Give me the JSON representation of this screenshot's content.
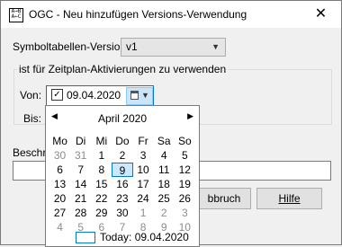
{
  "window": {
    "title": "OGC - Neu hinzufügen Versions-Verwendung",
    "app_icon_text": "A→B\nA←C",
    "close_glyph": "✕"
  },
  "form": {
    "symbol_label": "Symboltabellen-Version:",
    "symbol_value": "v1",
    "group_title": "ist für Zeitplan-Aktivierungen zu verwenden",
    "von_label": "Von:",
    "von_checked": true,
    "von_value": "09.04.2020",
    "bis_label": "Bis:",
    "beschreibung_label": "Beschre",
    "cancel_label": "Abbruch",
    "cancel_visible": "bbruch",
    "help_label": "Hilfe"
  },
  "calendar": {
    "month_title": "April 2020",
    "nav_prev": "◀",
    "nav_next": "▶",
    "weekdays": [
      "Mo",
      "Di",
      "Mi",
      "Do",
      "Fr",
      "Sa",
      "So"
    ],
    "weeks": [
      [
        "30",
        "31",
        "1",
        "2",
        "3",
        "4",
        "5"
      ],
      [
        "6",
        "7",
        "8",
        "9",
        "10",
        "11",
        "12"
      ],
      [
        "13",
        "14",
        "15",
        "16",
        "17",
        "18",
        "19"
      ],
      [
        "20",
        "21",
        "22",
        "23",
        "24",
        "25",
        "26"
      ],
      [
        "27",
        "28",
        "29",
        "30",
        "1",
        "2",
        "3"
      ],
      [
        "4",
        "5",
        "6",
        "7",
        "8",
        "9",
        "10"
      ]
    ],
    "today_text": "Today: 09.04.2020",
    "selected_day": "9"
  },
  "colors": {
    "accent": "#0078d7",
    "other_month": "#8c8c8c"
  }
}
